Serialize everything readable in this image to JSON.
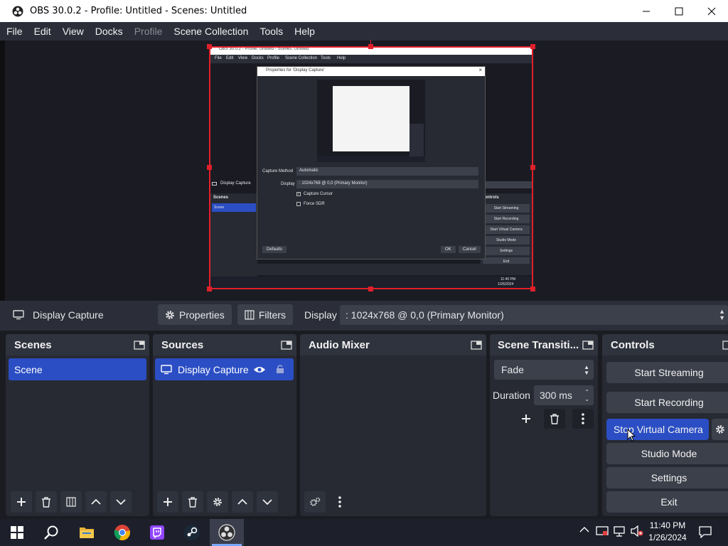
{
  "window": {
    "title": "OBS 30.0.2 - Profile: Untitled - Scenes: Untitled",
    "minimize_icon": "minimize-icon",
    "maximize_icon": "maximize-icon",
    "close_icon": "close-icon"
  },
  "menu": {
    "items": [
      {
        "label": "File",
        "enabled": true
      },
      {
        "label": "Edit",
        "enabled": true
      },
      {
        "label": "View",
        "enabled": true
      },
      {
        "label": "Docks",
        "enabled": true
      },
      {
        "label": "Profile",
        "enabled": false
      },
      {
        "label": "Scene Collection",
        "enabled": true
      },
      {
        "label": "Tools",
        "enabled": true
      },
      {
        "label": "Help",
        "enabled": true
      }
    ]
  },
  "nested_preview": {
    "title": "OBS 30.0.2 - Profile: Untitled - Scenes: Untitled",
    "menu": [
      "File",
      "Edit",
      "View",
      "Docks",
      "Profile",
      "Scene Collection",
      "Tools",
      "Help"
    ],
    "dialog_title": "Properties for 'Display Capture'",
    "capture_method_label": "Capture Method",
    "capture_method_value": "Automatic",
    "display_label": "Display",
    "display_value": ": 1024x768 @ 0,0 (Primary Monitor)",
    "capture_cursor_label": "Capture Cursor",
    "force_sdr_label": "Force SDR",
    "defaults_label": "Defaults",
    "ok_label": "OK",
    "cancel_label": "Cancel",
    "source_label": "Display Capture",
    "scenes_label": "Scenes",
    "scene_item": "Scene",
    "controls_label": "Controls",
    "controls": [
      "Start Streaming",
      "Start Recording",
      "Start Virtual Camera",
      "Studio Mode",
      "Settings",
      "Exit"
    ],
    "clock_time": "11:40 PM",
    "clock_date": "1/26/2024"
  },
  "source_toolbar": {
    "source_name": "Display Capture",
    "properties_label": "Properties",
    "filters_label": "Filters",
    "display_label": "Display",
    "display_value": ": 1024x768 @ 0,0 (Primary Monitor)"
  },
  "scenes": {
    "title": "Scenes",
    "items": [
      "Scene"
    ]
  },
  "sources": {
    "title": "Sources",
    "items": [
      {
        "name": "Display Capture",
        "visible": true,
        "locked": false
      }
    ]
  },
  "audio_mixer": {
    "title": "Audio Mixer"
  },
  "transitions": {
    "title": "Scene Transiti...",
    "selected": "Fade",
    "duration_label": "Duration",
    "duration_value": "300 ms"
  },
  "controls": {
    "title": "Controls",
    "start_streaming": "Start Streaming",
    "start_recording": "Start Recording",
    "virtual_camera": "Stop Virtual Camera",
    "studio_mode": "Studio Mode",
    "settings": "Settings",
    "exit": "Exit"
  },
  "taskbar": {
    "apps": [
      "start-icon",
      "search-icon",
      "file-explorer-icon",
      "chrome-icon",
      "twitch-icon",
      "steam-icon",
      "obs-icon"
    ],
    "time": "11:40 PM",
    "date": "1/26/2024"
  },
  "colors": {
    "accent": "#2b4ec4",
    "selection": "#e0202a",
    "panel": "#272a33",
    "button": "#3c404b"
  }
}
